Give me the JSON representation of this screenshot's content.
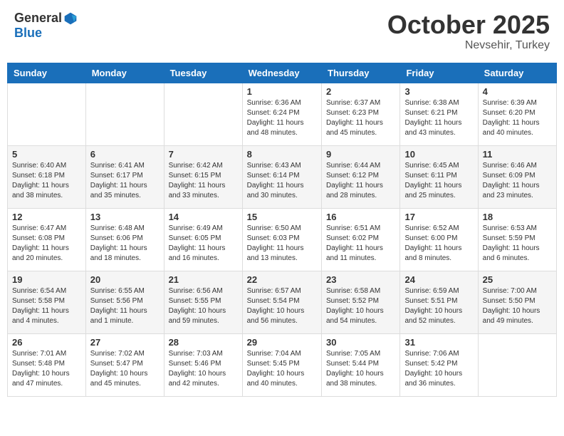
{
  "header": {
    "logo_general": "General",
    "logo_blue": "Blue",
    "month": "October 2025",
    "location": "Nevsehir, Turkey"
  },
  "weekdays": [
    "Sunday",
    "Monday",
    "Tuesday",
    "Wednesday",
    "Thursday",
    "Friday",
    "Saturday"
  ],
  "weeks": [
    [
      {
        "day": "",
        "info": ""
      },
      {
        "day": "",
        "info": ""
      },
      {
        "day": "",
        "info": ""
      },
      {
        "day": "1",
        "info": "Sunrise: 6:36 AM\nSunset: 6:24 PM\nDaylight: 11 hours\nand 48 minutes."
      },
      {
        "day": "2",
        "info": "Sunrise: 6:37 AM\nSunset: 6:23 PM\nDaylight: 11 hours\nand 45 minutes."
      },
      {
        "day": "3",
        "info": "Sunrise: 6:38 AM\nSunset: 6:21 PM\nDaylight: 11 hours\nand 43 minutes."
      },
      {
        "day": "4",
        "info": "Sunrise: 6:39 AM\nSunset: 6:20 PM\nDaylight: 11 hours\nand 40 minutes."
      }
    ],
    [
      {
        "day": "5",
        "info": "Sunrise: 6:40 AM\nSunset: 6:18 PM\nDaylight: 11 hours\nand 38 minutes."
      },
      {
        "day": "6",
        "info": "Sunrise: 6:41 AM\nSunset: 6:17 PM\nDaylight: 11 hours\nand 35 minutes."
      },
      {
        "day": "7",
        "info": "Sunrise: 6:42 AM\nSunset: 6:15 PM\nDaylight: 11 hours\nand 33 minutes."
      },
      {
        "day": "8",
        "info": "Sunrise: 6:43 AM\nSunset: 6:14 PM\nDaylight: 11 hours\nand 30 minutes."
      },
      {
        "day": "9",
        "info": "Sunrise: 6:44 AM\nSunset: 6:12 PM\nDaylight: 11 hours\nand 28 minutes."
      },
      {
        "day": "10",
        "info": "Sunrise: 6:45 AM\nSunset: 6:11 PM\nDaylight: 11 hours\nand 25 minutes."
      },
      {
        "day": "11",
        "info": "Sunrise: 6:46 AM\nSunset: 6:09 PM\nDaylight: 11 hours\nand 23 minutes."
      }
    ],
    [
      {
        "day": "12",
        "info": "Sunrise: 6:47 AM\nSunset: 6:08 PM\nDaylight: 11 hours\nand 20 minutes."
      },
      {
        "day": "13",
        "info": "Sunrise: 6:48 AM\nSunset: 6:06 PM\nDaylight: 11 hours\nand 18 minutes."
      },
      {
        "day": "14",
        "info": "Sunrise: 6:49 AM\nSunset: 6:05 PM\nDaylight: 11 hours\nand 16 minutes."
      },
      {
        "day": "15",
        "info": "Sunrise: 6:50 AM\nSunset: 6:03 PM\nDaylight: 11 hours\nand 13 minutes."
      },
      {
        "day": "16",
        "info": "Sunrise: 6:51 AM\nSunset: 6:02 PM\nDaylight: 11 hours\nand 11 minutes."
      },
      {
        "day": "17",
        "info": "Sunrise: 6:52 AM\nSunset: 6:00 PM\nDaylight: 11 hours\nand 8 minutes."
      },
      {
        "day": "18",
        "info": "Sunrise: 6:53 AM\nSunset: 5:59 PM\nDaylight: 11 hours\nand 6 minutes."
      }
    ],
    [
      {
        "day": "19",
        "info": "Sunrise: 6:54 AM\nSunset: 5:58 PM\nDaylight: 11 hours\nand 4 minutes."
      },
      {
        "day": "20",
        "info": "Sunrise: 6:55 AM\nSunset: 5:56 PM\nDaylight: 11 hours\nand 1 minute."
      },
      {
        "day": "21",
        "info": "Sunrise: 6:56 AM\nSunset: 5:55 PM\nDaylight: 10 hours\nand 59 minutes."
      },
      {
        "day": "22",
        "info": "Sunrise: 6:57 AM\nSunset: 5:54 PM\nDaylight: 10 hours\nand 56 minutes."
      },
      {
        "day": "23",
        "info": "Sunrise: 6:58 AM\nSunset: 5:52 PM\nDaylight: 10 hours\nand 54 minutes."
      },
      {
        "day": "24",
        "info": "Sunrise: 6:59 AM\nSunset: 5:51 PM\nDaylight: 10 hours\nand 52 minutes."
      },
      {
        "day": "25",
        "info": "Sunrise: 7:00 AM\nSunset: 5:50 PM\nDaylight: 10 hours\nand 49 minutes."
      }
    ],
    [
      {
        "day": "26",
        "info": "Sunrise: 7:01 AM\nSunset: 5:48 PM\nDaylight: 10 hours\nand 47 minutes."
      },
      {
        "day": "27",
        "info": "Sunrise: 7:02 AM\nSunset: 5:47 PM\nDaylight: 10 hours\nand 45 minutes."
      },
      {
        "day": "28",
        "info": "Sunrise: 7:03 AM\nSunset: 5:46 PM\nDaylight: 10 hours\nand 42 minutes."
      },
      {
        "day": "29",
        "info": "Sunrise: 7:04 AM\nSunset: 5:45 PM\nDaylight: 10 hours\nand 40 minutes."
      },
      {
        "day": "30",
        "info": "Sunrise: 7:05 AM\nSunset: 5:44 PM\nDaylight: 10 hours\nand 38 minutes."
      },
      {
        "day": "31",
        "info": "Sunrise: 7:06 AM\nSunset: 5:42 PM\nDaylight: 10 hours\nand 36 minutes."
      },
      {
        "day": "",
        "info": ""
      }
    ]
  ]
}
